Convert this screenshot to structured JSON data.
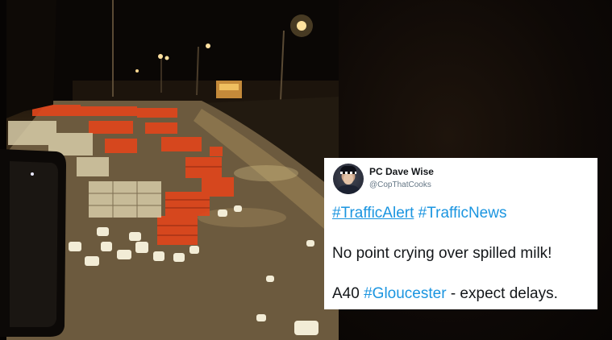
{
  "photo": {
    "alt": "Night road scene with crates and milk bottles spilled across a wet road"
  },
  "tweet": {
    "display_name": "PC Dave Wise",
    "handle": "@CopThatCooks",
    "line1": {
      "tag1": "#TrafficAlert",
      "tag2": "#TrafficNews"
    },
    "line2": "No point crying over spilled milk!",
    "line3": {
      "prefix": "A40",
      "tag": "#Gloucester",
      "suffix": "- expect delays."
    }
  },
  "colors": {
    "link": "#1b95e0",
    "text": "#14171a",
    "handle": "#657786",
    "crate": "#e0461c"
  }
}
